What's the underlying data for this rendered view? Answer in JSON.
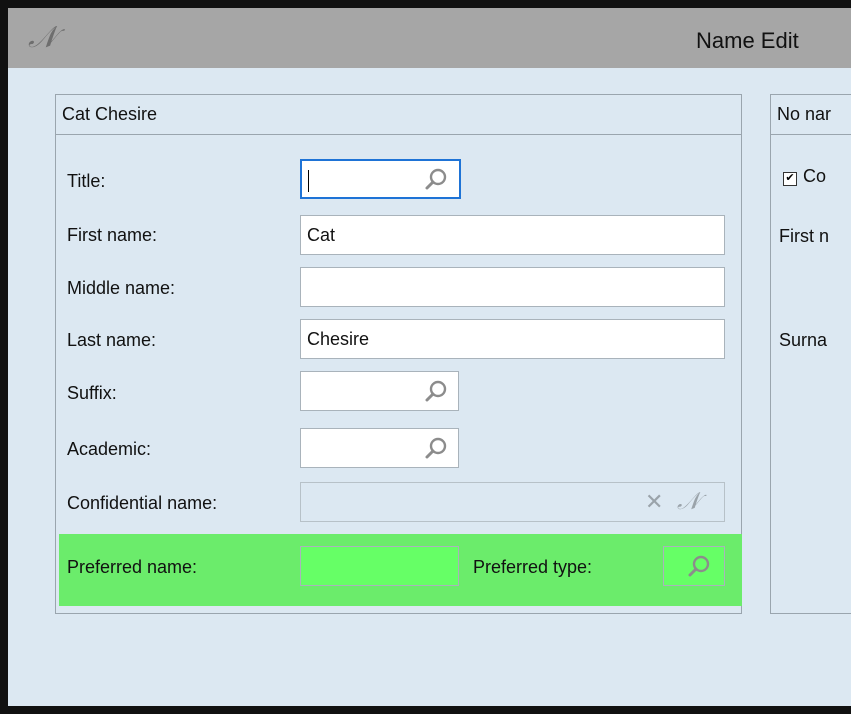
{
  "window": {
    "title": "Name Edit",
    "logo_glyph": "𝒩"
  },
  "name_panel": {
    "header": "Cat Chesire",
    "fields": {
      "title": {
        "label": "Title:",
        "value": ""
      },
      "first_name": {
        "label": "First name:",
        "value": "Cat"
      },
      "middle_name": {
        "label": "Middle name:",
        "value": ""
      },
      "last_name": {
        "label": "Last name:",
        "value": "Chesire"
      },
      "suffix": {
        "label": "Suffix:",
        "value": ""
      },
      "academic": {
        "label": "Academic:",
        "value": ""
      },
      "confidential_name": {
        "label": "Confidential name:",
        "value": ""
      },
      "preferred_name": {
        "label": "Preferred name:",
        "value": ""
      },
      "preferred_type": {
        "label": "Preferred type:",
        "value": ""
      }
    },
    "clear_glyph": "✕",
    "n_glyph": "𝒩"
  },
  "second_panel": {
    "header": "No nar",
    "checkbox_label": "Co",
    "checkbox_checked": true,
    "checkbox_glyph": "✔",
    "first_label": "First n",
    "surname_label": "Surna"
  },
  "colors": {
    "titlebar": "#a6a6a6",
    "content_bg": "#dce8f2",
    "preferred_band": "#6bec6b",
    "focus_border": "#1e73d6"
  }
}
